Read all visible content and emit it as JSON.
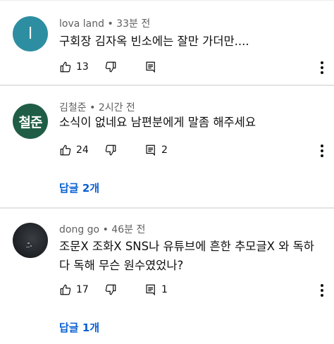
{
  "colors": {
    "link": "#065fd4",
    "meta_text": "#606060",
    "avatar_1": "#2e8ea1",
    "avatar_2": "#1f5d47"
  },
  "comments": [
    {
      "author": "lova land",
      "time": "33분 전",
      "avatar_text": "l",
      "text": "구회장 김자옥 빈소에는 잘만 가더만....",
      "likes": "13",
      "replies_count": "",
      "replies_link": ""
    },
    {
      "author": "김철준",
      "time": "2시간 전",
      "avatar_text": "철준",
      "text": "소식이 없네요 남편분에게 말좀 해주세요",
      "likes": "24",
      "replies_count": "2",
      "replies_link": "답글 2개"
    },
    {
      "author": "dong go",
      "time": "46분 전",
      "avatar_text": "",
      "text": "조문X 조화X SNS나 유튜브에 흔한 추모글X  와 독하다 독해 무슨 원수였었나?",
      "likes": "17",
      "replies_count": "1",
      "replies_link": "답글 1개"
    }
  ],
  "meta_separator": " • ",
  "icons": {
    "like": "thumb-up-icon",
    "dislike": "thumb-down-icon",
    "reply": "reply-icon",
    "more": "more-vert-icon"
  }
}
